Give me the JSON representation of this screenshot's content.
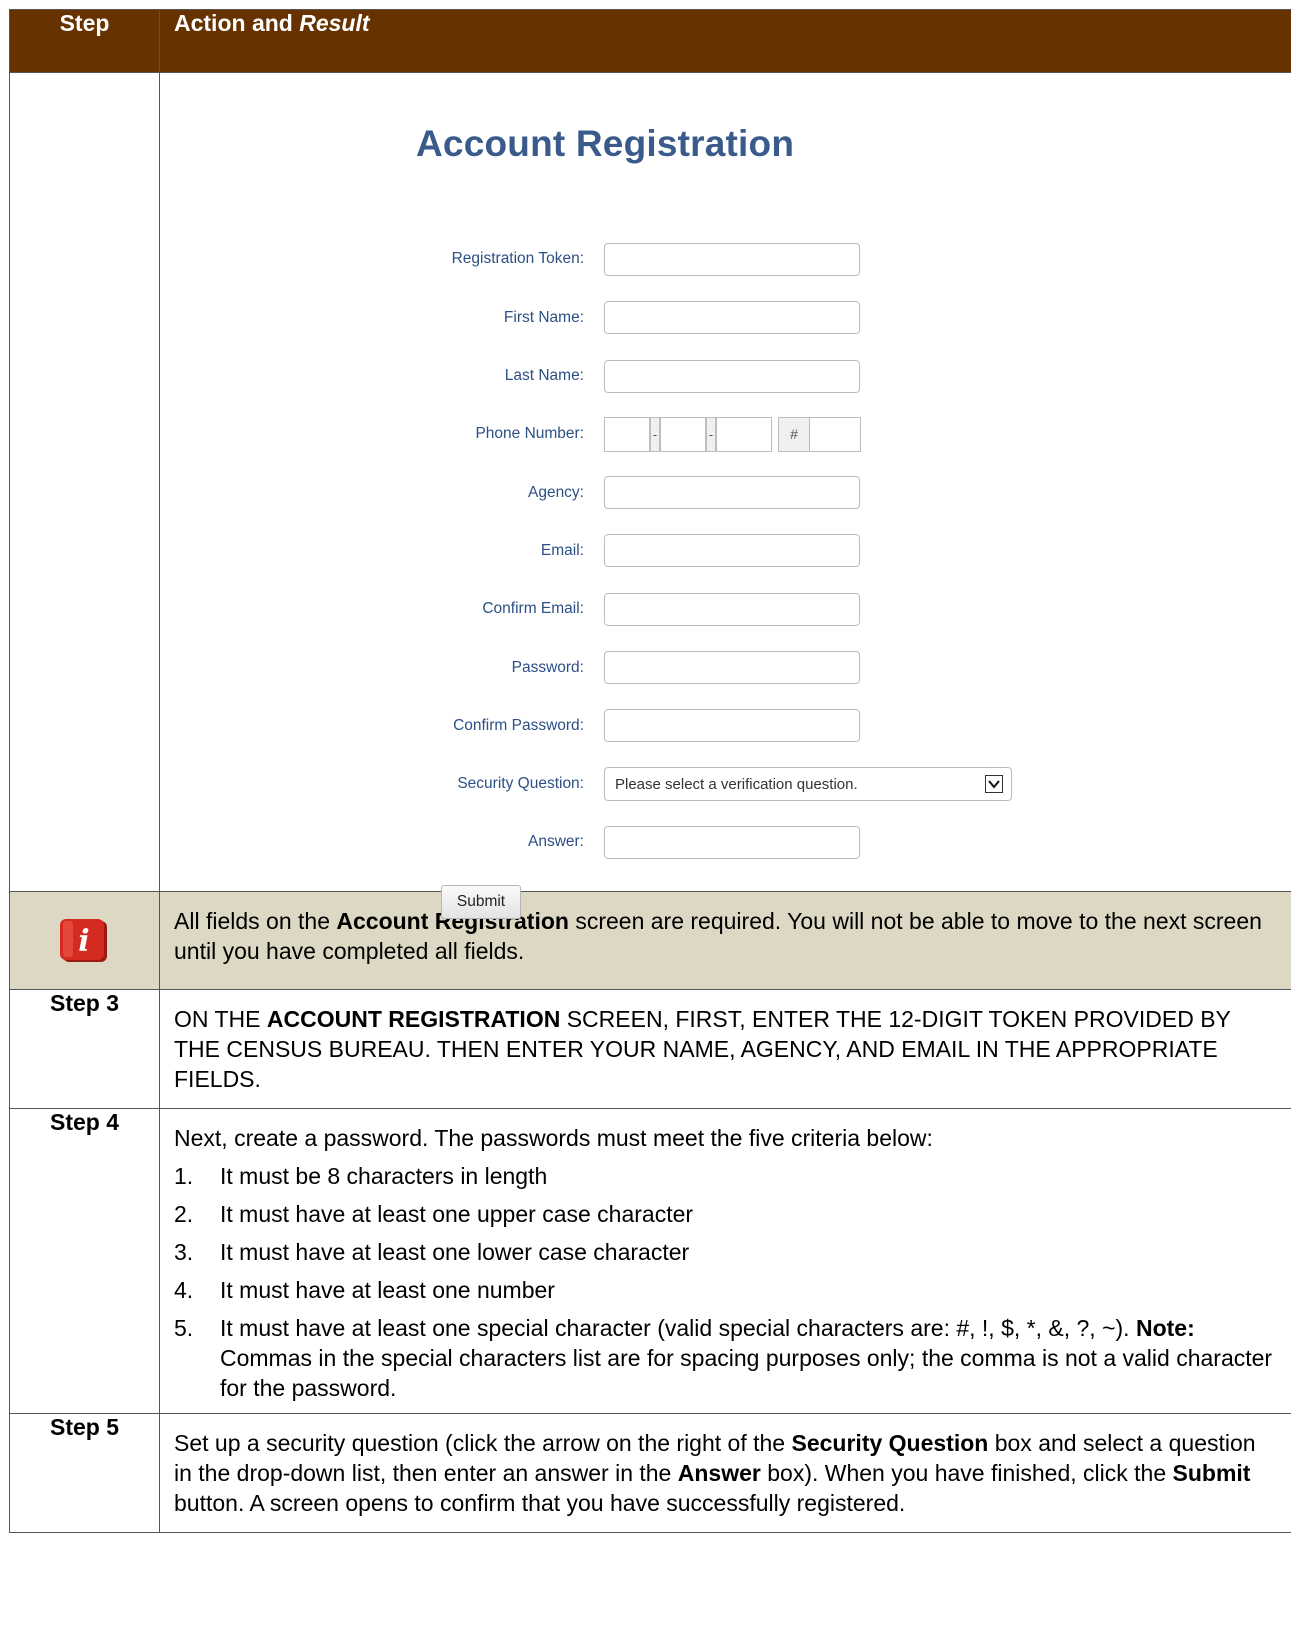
{
  "header": {
    "step_label": "Step",
    "action_label": "Action and ",
    "result_label": "Result"
  },
  "form": {
    "title": "Account Registration",
    "labels": {
      "token": "Registration Token:",
      "first_name": "First Name:",
      "last_name": "Last Name:",
      "phone": "Phone Number:",
      "agency": "Agency:",
      "email": "Email:",
      "confirm_email": "Confirm Email:",
      "password": "Password:",
      "confirm_password": "Confirm Password:",
      "security_question": "Security Question:",
      "answer": "Answer:"
    },
    "phone_dash": "-",
    "phone_ext": "#",
    "security_question_value": "Please select a verification question.",
    "submit_label": "Submit"
  },
  "note": {
    "icon_letter": "i",
    "text_1": "All fields on the ",
    "bold_1": "Account Registration",
    "text_2": " screen are required. You will not be able to move to the next screen until you have completed all fields."
  },
  "step3": {
    "label": "Step 3",
    "text_1": "ON THE ",
    "bold_1": "ACCOUNT REGISTRATION",
    "text_2": " SCREEN, FIRST, ENTER THE 12-DIGIT TOKEN PROVIDED BY THE CENSUS BUREAU. THEN ENTER YOUR NAME, AGENCY, AND EMAIL IN THE APPROPRIATE FIELDS."
  },
  "step4": {
    "label": "Step 4",
    "intro": "Next, create a password. The passwords must meet the five criteria below:",
    "criteria": [
      {
        "num": "1.",
        "text": "It must be 8 characters in length"
      },
      {
        "num": "2.",
        "text": "It must have at least one upper case character"
      },
      {
        "num": "3.",
        "text": "It must have at least one lower case character"
      },
      {
        "num": "4.",
        "text": "It must have at least one number"
      },
      {
        "num": "5.",
        "text": "It must have at least one special character (valid special characters are: #, !, $, *, &, ?, ~).",
        "note_label": "Note:",
        "note_text": "  Commas in the special characters list are for spacing purposes only; the comma is not a valid character for the password."
      }
    ]
  },
  "step5": {
    "label": "Step 5",
    "t1": "Set up a security question (click the arrow on the right of the ",
    "b1": "Security Question",
    "t2": " box and select a question in the drop-down list, then enter an answer in the ",
    "b2": "Answer",
    "t3": " box). When you have finished, click the ",
    "b3": "Submit",
    "t4": " button. A screen opens to confirm that you have successfully registered."
  },
  "colors": {
    "header_bg": "#663300",
    "note_bg": "#ddd8c4",
    "form_label": "#2c4f84",
    "form_title": "#3a5a8c",
    "icon_red": "#d42a1f"
  }
}
